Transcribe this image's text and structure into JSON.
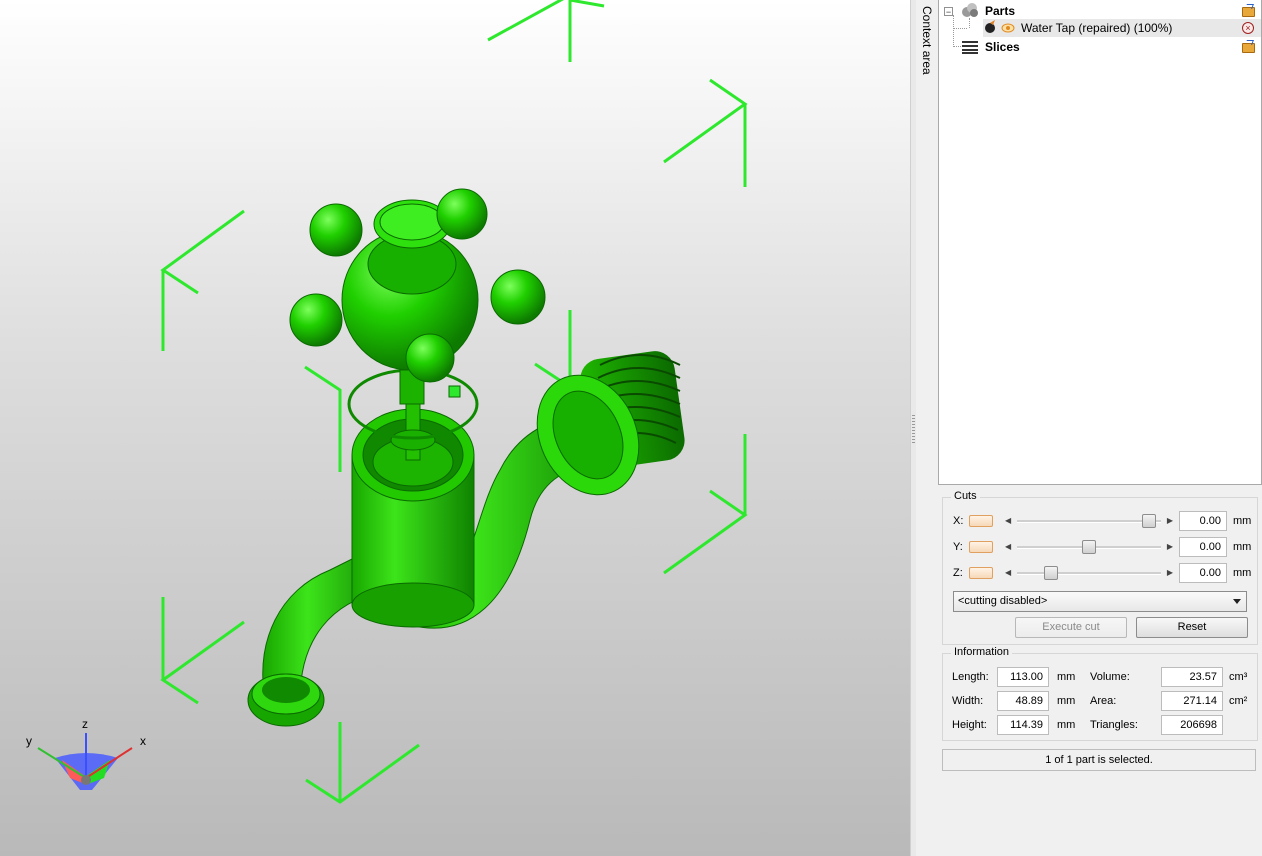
{
  "context_tab": {
    "label": "Context area"
  },
  "tree": {
    "parts_label": "Parts",
    "part_item_label": "Water Tap (repaired) (100%)",
    "slices_label": "Slices",
    "expander_symbol": "−"
  },
  "cuts": {
    "title": "Cuts",
    "axes": [
      {
        "label": "X:",
        "value": "0.00",
        "unit": "mm",
        "slider_fraction": 0.96
      },
      {
        "label": "Y:",
        "value": "0.00",
        "unit": "mm",
        "slider_fraction": 0.5
      },
      {
        "label": "Z:",
        "value": "0.00",
        "unit": "mm",
        "slider_fraction": 0.21
      }
    ],
    "mode_select": "<cutting disabled>",
    "execute_label": "Execute cut",
    "reset_label": "Reset"
  },
  "information": {
    "title": "Information",
    "length_label": "Length:",
    "length_value": "113.00",
    "length_unit": "mm",
    "width_label": "Width:",
    "width_value": "48.89",
    "width_unit": "mm",
    "height_label": "Height:",
    "height_value": "114.39",
    "height_unit": "mm",
    "volume_label": "Volume:",
    "volume_value": "23.57",
    "volume_unit": "cm³",
    "area_label": "Area:",
    "area_value": "271.14",
    "area_unit": "cm²",
    "triangles_label": "Triangles:",
    "triangles_value": "206698"
  },
  "status": {
    "text": "1 of 1 part is selected."
  },
  "axes_gizmo": {
    "x": "x",
    "y": "y",
    "z": "z"
  },
  "colors": {
    "model": "#22cc00",
    "bounding_box": "#2ee82e",
    "accent": "#e8a050"
  }
}
